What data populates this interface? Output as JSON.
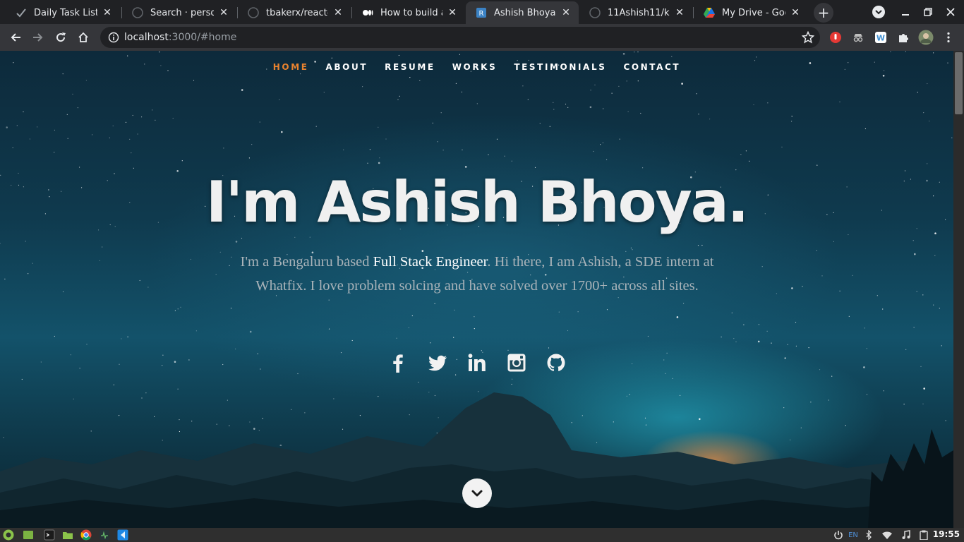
{
  "browser": {
    "tabs": [
      {
        "title": "Daily Task List",
        "icon": "check-icon",
        "active": false
      },
      {
        "title": "Search · persona",
        "icon": "github-icon",
        "active": false
      },
      {
        "title": "tbakerx/react-re",
        "icon": "github-icon",
        "active": false
      },
      {
        "title": "How to build an",
        "icon": "medium-icon",
        "active": false
      },
      {
        "title": "Ashish Bhoya",
        "icon": "react-icon",
        "active": true
      },
      {
        "title": "11Ashish11/kau",
        "icon": "github-icon",
        "active": false
      },
      {
        "title": "My Drive - Googl",
        "icon": "drive-icon",
        "active": false
      }
    ],
    "close_glyph": "✕",
    "newtab_glyph": "+",
    "address": {
      "host": "localhost",
      "path": ":3000/#home"
    }
  },
  "site": {
    "nav": [
      "HOME",
      "ABOUT",
      "RESUME",
      "WORKS",
      "TESTIMONIALS",
      "CONTACT"
    ],
    "nav_active": "HOME",
    "accent_color": "#e8832f",
    "headline": "I'm Ashish Bhoya.",
    "intro": {
      "before": "I'm a Bengaluru based ",
      "emphasis": "Full Stack Engineer",
      "after": ". Hi there, I am Ashish, a SDE intern at Whatfix. I love problem solcing and have solved over 1700+ across all sites."
    },
    "social": [
      "facebook-icon",
      "twitter-icon",
      "linkedin-icon",
      "instagram-icon",
      "github-icon"
    ]
  },
  "taskbar": {
    "lang": "EN",
    "time": "19:55"
  }
}
